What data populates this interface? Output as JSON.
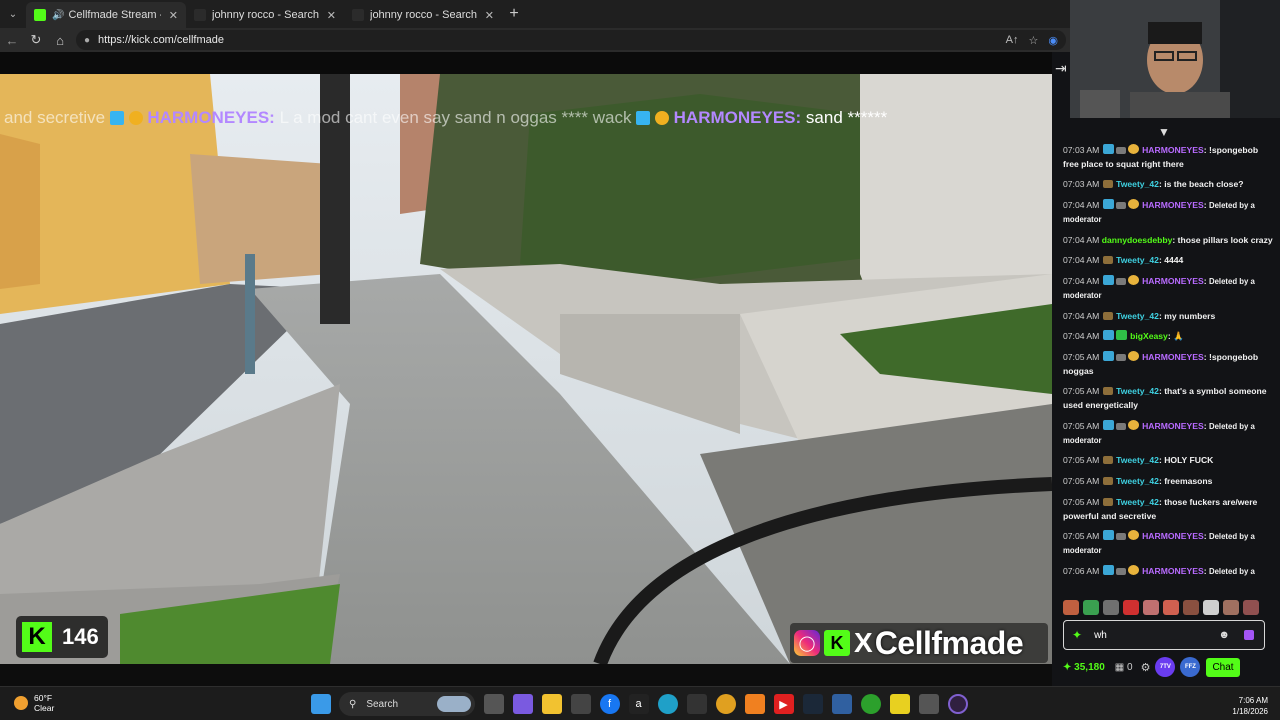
{
  "browser": {
    "tabs": [
      {
        "label": "Cellfmade Stream - Watch Liv",
        "active": true,
        "icon_color": "#53fc18"
      },
      {
        "label": "johnny rocco - Search",
        "active": false
      },
      {
        "label": "johnny rocco - Search Images",
        "active": false
      }
    ],
    "url": "https://kick.com/cellfmade"
  },
  "video": {
    "overlay_text": {
      "p1": "and secretive",
      "u1": "HARMONEYES:",
      "p2": "L a  mod cant even say sand n oggas **** wack",
      "u2": "HARMONEYES:",
      "p3": "sand ******"
    },
    "viewer_count": "146",
    "kick_logo": "K",
    "brand_name": "Cellfmade",
    "brand_x": "X"
  },
  "chat": {
    "messages": [
      {
        "time": "07:03 AM",
        "user": "HARMONEYES",
        "user_color": "#b86bff",
        "text": "!spongebob free place to squat right there",
        "badges": [
          "sub",
          "mod",
          "gift"
        ]
      },
      {
        "time": "07:03 AM",
        "user": "Tweety_42",
        "user_color": "#3fd0e0",
        "text": "is the beach close?",
        "badges": [
          "hat"
        ]
      },
      {
        "time": "07:04 AM",
        "user": "HARMONEYES",
        "user_color": "#b86bff",
        "text": "Deleted by a moderator",
        "badges": [
          "sub",
          "mod",
          "gift"
        ],
        "deleted": true
      },
      {
        "time": "07:04 AM",
        "user": "dannydoesdebby",
        "user_color": "#53fc18",
        "text": "those pillars look crazy",
        "badges": []
      },
      {
        "time": "07:04 AM",
        "user": "Tweety_42",
        "user_color": "#3fd0e0",
        "text": "4444",
        "badges": [
          "hat"
        ]
      },
      {
        "time": "07:04 AM",
        "user": "HARMONEYES",
        "user_color": "#b86bff",
        "text": "Deleted by a moderator",
        "badges": [
          "sub",
          "mod",
          "gift"
        ],
        "deleted": true
      },
      {
        "time": "07:04 AM",
        "user": "Tweety_42",
        "user_color": "#3fd0e0",
        "text": "my numbers",
        "badges": [
          "hat"
        ]
      },
      {
        "time": "07:04 AM",
        "user": "bigXeasy",
        "user_color": "#53fc18",
        "text": "🙏",
        "badges": [
          "sub",
          "grn"
        ]
      },
      {
        "time": "07:05 AM",
        "user": "HARMONEYES",
        "user_color": "#b86bff",
        "text": "!spongebob noggas",
        "badges": [
          "sub",
          "mod",
          "gift"
        ]
      },
      {
        "time": "07:05 AM",
        "user": "Tweety_42",
        "user_color": "#3fd0e0",
        "text": "that's a symbol someone used energetically",
        "badges": [
          "hat"
        ]
      },
      {
        "time": "07:05 AM",
        "user": "HARMONEYES",
        "user_color": "#b86bff",
        "text": "Deleted by a moderator",
        "badges": [
          "sub",
          "mod",
          "gift"
        ],
        "deleted": true
      },
      {
        "time": "07:05 AM",
        "user": "Tweety_42",
        "user_color": "#3fd0e0",
        "text": "HOLY FUCK",
        "badges": [
          "hat"
        ]
      },
      {
        "time": "07:05 AM",
        "user": "Tweety_42",
        "user_color": "#3fd0e0",
        "text": "freemasons",
        "badges": [
          "hat"
        ]
      },
      {
        "time": "07:05 AM",
        "user": "Tweety_42",
        "user_color": "#3fd0e0",
        "text": "those fuckers are/were powerful and secretive",
        "badges": [
          "hat"
        ]
      },
      {
        "time": "07:05 AM",
        "user": "HARMONEYES",
        "user_color": "#b86bff",
        "text": "Deleted by a moderator",
        "badges": [
          "sub",
          "mod",
          "gift"
        ],
        "deleted": true
      },
      {
        "time": "07:06 AM",
        "user": "HARMONEYES",
        "user_color": "#b86bff",
        "text": "Deleted by a",
        "badges": [
          "sub",
          "mod",
          "gift"
        ],
        "deleted": true
      }
    ],
    "input_value": "wh",
    "points": "35,180",
    "slot_count": "0",
    "ext_7tv": "7TV",
    "ext_ffz": "FFZ",
    "send_label": "Chat",
    "accent": "#53fc18"
  },
  "taskbar": {
    "weather_temp": "60°F",
    "weather_desc": "Clear",
    "search_label": "Search",
    "time": "7:06 AM",
    "date": "1/18/2026"
  }
}
